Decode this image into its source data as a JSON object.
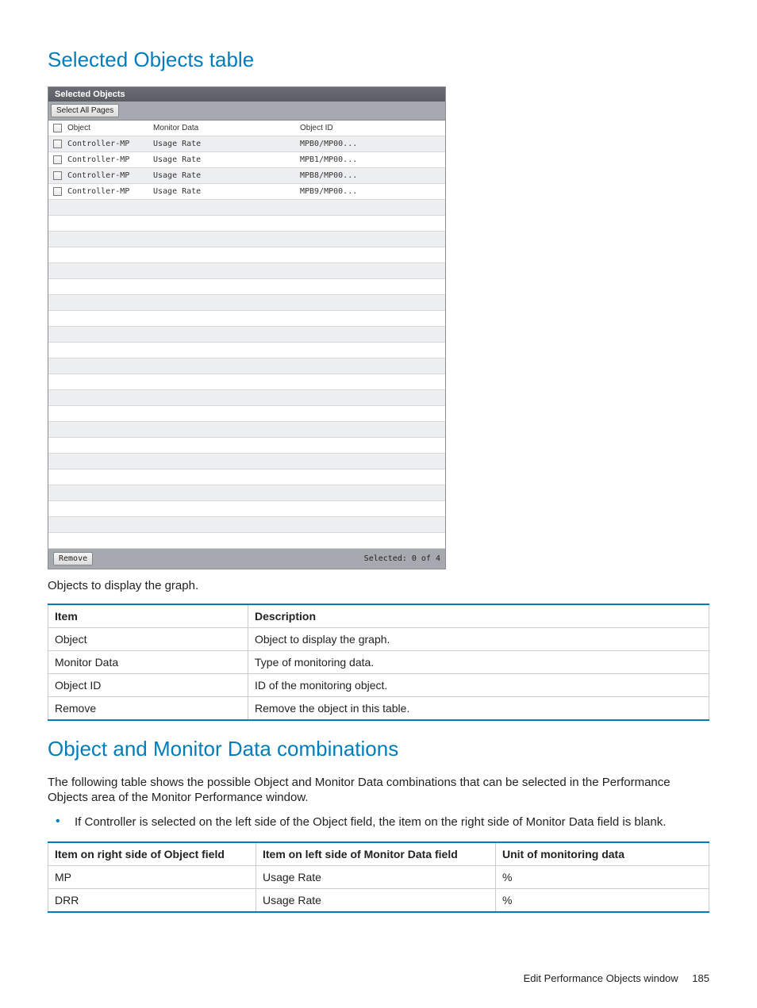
{
  "headings": {
    "selected_objects_table": "Selected Objects table",
    "combinations": "Object and Monitor Data combinations"
  },
  "selected_objects_panel": {
    "title": "Selected Objects",
    "select_all_btn": "Select All Pages",
    "headers": {
      "object": "Object",
      "monitor_data": "Monitor Data",
      "object_id": "Object ID"
    },
    "rows": [
      {
        "object": "Controller-MP",
        "monitor_data": "Usage Rate",
        "object_id": "MPB0/MP00..."
      },
      {
        "object": "Controller-MP",
        "monitor_data": "Usage Rate",
        "object_id": "MPB1/MP00..."
      },
      {
        "object": "Controller-MP",
        "monitor_data": "Usage Rate",
        "object_id": "MPB8/MP00..."
      },
      {
        "object": "Controller-MP",
        "monitor_data": "Usage Rate",
        "object_id": "MPB9/MP00..."
      }
    ],
    "empty_row_count": 22,
    "remove_btn": "Remove",
    "footer_status": "Selected: 0  of 4"
  },
  "intro_text": "Objects to display the graph.",
  "desc_table": {
    "headers": {
      "item": "Item",
      "description": "Description"
    },
    "rows": [
      {
        "item": "Object",
        "description": "Object to display the graph."
      },
      {
        "item": "Monitor Data",
        "description": "Type of monitoring data."
      },
      {
        "item": "Object ID",
        "description": "ID of the monitoring object."
      },
      {
        "item": "Remove",
        "description": "Remove the object in this table."
      }
    ]
  },
  "combinations_intro": "The following table shows the possible Object and Monitor Data combinations that can be selected in the Performance Objects area of the Monitor Performance window.",
  "bullets": [
    "If Controller is selected on the left side of the Object field, the item on the right side of Monitor Data field is blank."
  ],
  "comb_table": {
    "headers": {
      "col1": "Item on right side of Object field",
      "col2": "Item on left side of Monitor Data field",
      "col3": "Unit of monitoring data"
    },
    "rows": [
      {
        "c1": "MP",
        "c2": "Usage Rate",
        "c3": "%"
      },
      {
        "c1": "DRR",
        "c2": "Usage Rate",
        "c3": "%"
      }
    ]
  },
  "footer": {
    "title": "Edit Performance Objects window",
    "page": "185"
  }
}
